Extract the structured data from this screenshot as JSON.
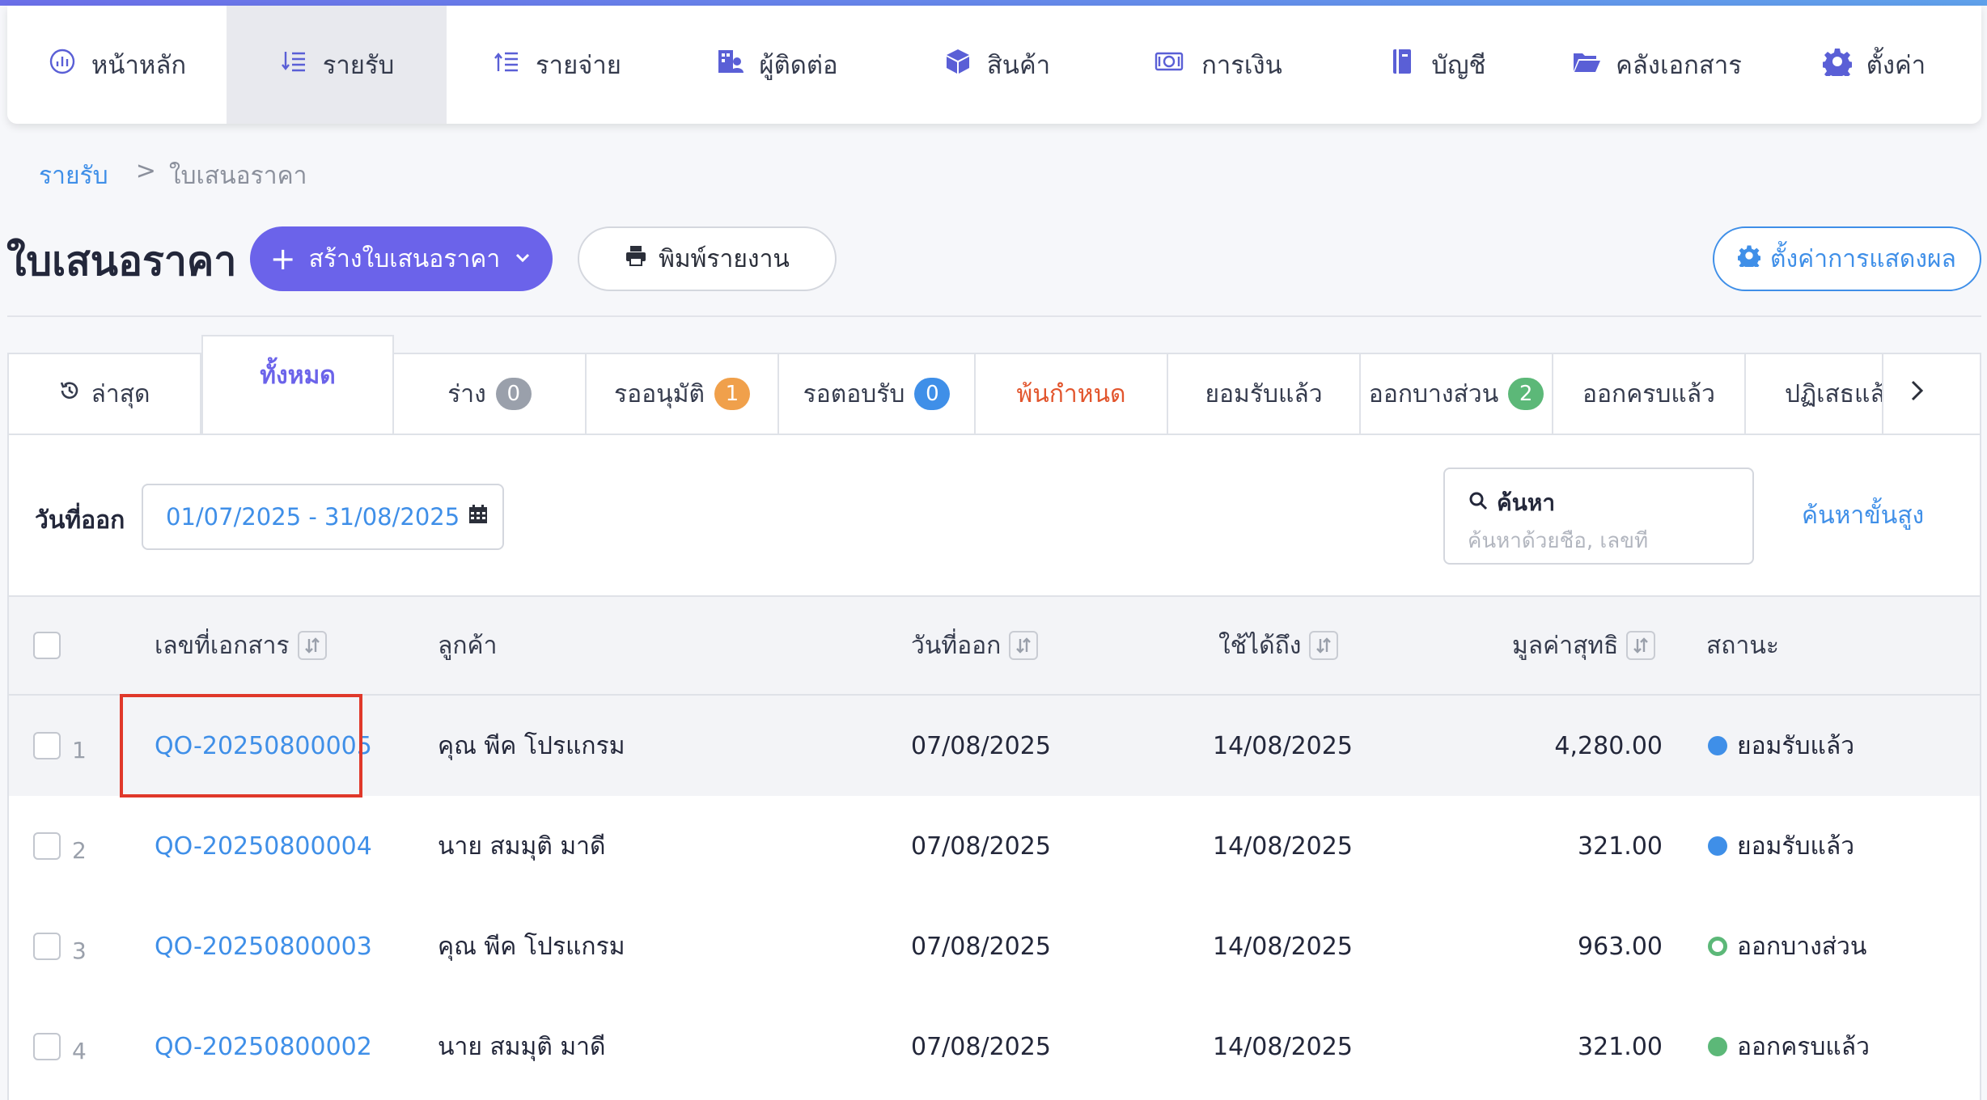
{
  "nav": {
    "items": [
      {
        "label": "หน้าหลัก",
        "icon": "dashboard-icon"
      },
      {
        "label": "รายรับ",
        "icon": "income-icon"
      },
      {
        "label": "รายจ่าย",
        "icon": "expense-icon"
      },
      {
        "label": "ผู้ติดต่อ",
        "icon": "contacts-icon"
      },
      {
        "label": "สินค้า",
        "icon": "box-icon"
      },
      {
        "label": "การเงิน",
        "icon": "money-icon"
      },
      {
        "label": "บัญชี",
        "icon": "ledger-book-icon"
      },
      {
        "label": "คลังเอกสาร",
        "icon": "folder-icon"
      },
      {
        "label": "ตั้งค่า",
        "icon": "gear-icon"
      }
    ],
    "active": "รายรับ"
  },
  "breadcrumb": {
    "parent": "รายรับ",
    "separator": ">",
    "current": "ใบเสนอราคา"
  },
  "header": {
    "title": "ใบเสนอราคา",
    "create_button": "สร้างใบเสนอราคา",
    "print_button": "พิมพ์รายงาน",
    "display_settings_button": "ตั้งค่าการแสดงผล"
  },
  "tabs": [
    {
      "label": "ล่าสุด",
      "badge": null
    },
    {
      "label": "ทั้งหมด",
      "badge": null
    },
    {
      "label": "ร่าง",
      "badge": "0"
    },
    {
      "label": "รออนุมัติ",
      "badge": "1"
    },
    {
      "label": "รอตอบรับ",
      "badge": "0"
    },
    {
      "label": "พ้นกำหนด",
      "badge": null
    },
    {
      "label": "ยอมรับแล้ว",
      "badge": null
    },
    {
      "label": "ออกบางส่วน",
      "badge": "2"
    },
    {
      "label": "ออกครบแล้ว",
      "badge": null
    },
    {
      "label": "ปฏิเสธแล้ว",
      "badge": null
    }
  ],
  "filter": {
    "date_label": "วันที่ออก",
    "date_range": "01/07/2025 - 31/08/2025",
    "search_label": "ค้นหา",
    "search_placeholder": "ค้นหาด้วยชื่อ, เลขที่",
    "advanced_search": "ค้นหาขั้นสูง"
  },
  "table": {
    "headers": {
      "doc_no": "เลขที่เอกสาร",
      "customer": "ลูกค้า",
      "issue_date": "วันที่ออก",
      "valid_until": "ใช้ได้ถึง",
      "net_value": "มูลค่าสุทธิ",
      "status": "สถานะ"
    },
    "rows": [
      {
        "num": "1",
        "doc_no": "QO-20250800005",
        "customer": "คุณ พีค โปรแกรม",
        "issue_date": "07/08/2025",
        "valid_until": "14/08/2025",
        "net_value": "4,280.00",
        "status": "ยอมรับแล้ว"
      },
      {
        "num": "2",
        "doc_no": "QO-20250800004",
        "customer": "นาย สมมุติ มาดี",
        "issue_date": "07/08/2025",
        "valid_until": "14/08/2025",
        "net_value": "321.00",
        "status": "ยอมรับแล้ว"
      },
      {
        "num": "3",
        "doc_no": "QO-20250800003",
        "customer": "คุณ พีค โปรแกรม",
        "issue_date": "07/08/2025",
        "valid_until": "14/08/2025",
        "net_value": "963.00",
        "status": "ออกบางส่วน"
      },
      {
        "num": "4",
        "doc_no": "QO-20250800002",
        "customer": "นาย สมมุติ มาดี",
        "issue_date": "07/08/2025",
        "valid_until": "14/08/2025",
        "net_value": "321.00",
        "status": "ออกครบแล้ว"
      }
    ]
  },
  "colors": {
    "accent": "#6b63ea",
    "link": "#3f8fe8",
    "overdue": "#e2552d",
    "highlight_border": "#e0382a"
  }
}
